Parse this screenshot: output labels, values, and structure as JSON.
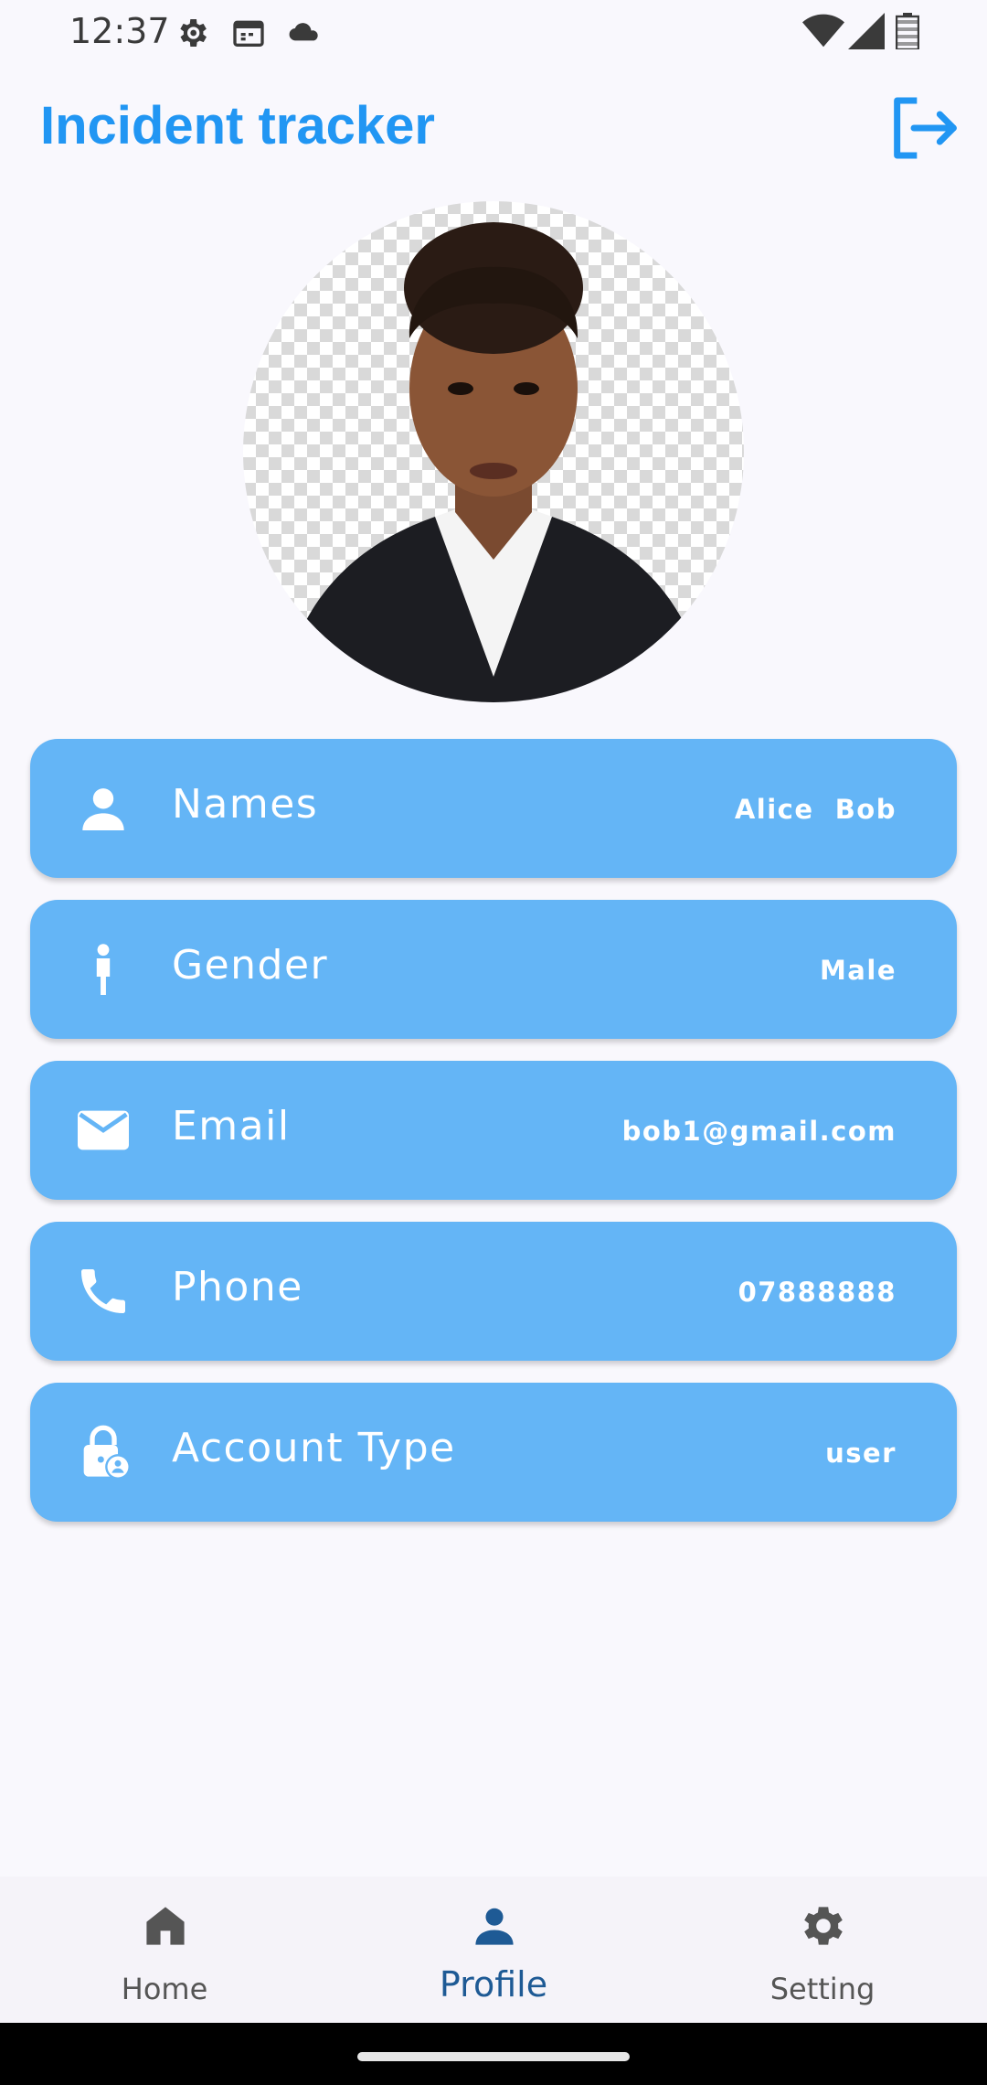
{
  "status_bar": {
    "time": "12:37",
    "icons": [
      "settings-gear-icon",
      "calendar-icon",
      "cloud-icon",
      "wifi-icon",
      "signal-icon",
      "battery-icon"
    ]
  },
  "app_bar": {
    "title": "Incident tracker",
    "logout_icon": "logout-icon"
  },
  "colors": {
    "accent": "#2196f3",
    "card_bg": "#64b5f6",
    "card_text": "#ffffff",
    "nav_active": "#1e5a95",
    "nav_inactive": "#555555"
  },
  "profile": {
    "avatar": "profile-photo",
    "fields": [
      {
        "icon": "person-icon",
        "label": "Names",
        "value": "Alice  Bob"
      },
      {
        "icon": "male-icon",
        "label": "Gender",
        "value": "Male"
      },
      {
        "icon": "email-icon",
        "label": "Email",
        "value": "bob1@gmail.com"
      },
      {
        "icon": "phone-icon",
        "label": "Phone",
        "value": "07888888"
      },
      {
        "icon": "lock-person-icon",
        "label": "Account Type",
        "value": "user"
      }
    ]
  },
  "bottom_nav": {
    "items": [
      {
        "icon": "home-icon",
        "label": "Home",
        "active": false
      },
      {
        "icon": "person-icon",
        "label": "Profile",
        "active": true
      },
      {
        "icon": "gear-icon",
        "label": "Setting",
        "active": false
      }
    ]
  }
}
